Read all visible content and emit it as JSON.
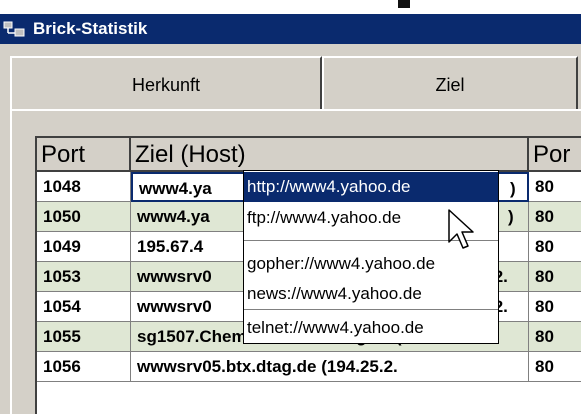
{
  "window": {
    "title": "Brick-Statistik",
    "icon": "network-app-icon"
  },
  "tabs": [
    {
      "label": "Herkunft"
    },
    {
      "label": "Ziel"
    }
  ],
  "table": {
    "columns": [
      "Port",
      "Ziel (Host)",
      "Por"
    ],
    "rows": [
      {
        "port": "1048",
        "host": "www4.ya",
        "host_tail": ")",
        "port2": "80",
        "selected": true
      },
      {
        "port": "1050",
        "host": "www4.ya",
        "host_tail": ")",
        "port2": "80"
      },
      {
        "port": "1049",
        "host": "195.67.4",
        "host_tail": "",
        "port2": "80"
      },
      {
        "port": "1053",
        "host": "wwwsrv0",
        "host_tail": ".2.",
        "port2": "80"
      },
      {
        "port": "1054",
        "host": "wwwsrv0",
        "host_tail": ".2.",
        "port2": "80"
      },
      {
        "port": "1055",
        "host": "sg1507.Chemie.Uni-Marburg.de (",
        "host_tail": "",
        "port2": "80"
      },
      {
        "port": "1056",
        "host": "wwwsrv05.btx.dtag.de (194.25.2.",
        "host_tail": "",
        "port2": "80"
      }
    ]
  },
  "dropdown": {
    "items": [
      "http://www4.yahoo.de",
      "ftp://www4.yahoo.de",
      "gopher://www4.yahoo.de",
      "news://www4.yahoo.de",
      "telnet://www4.yahoo.de"
    ],
    "selected_index": 0
  },
  "colors": {
    "titlebar": "#0a2a6e",
    "row_alt": "#dfe7d4",
    "chrome": "#d4d0c8"
  }
}
